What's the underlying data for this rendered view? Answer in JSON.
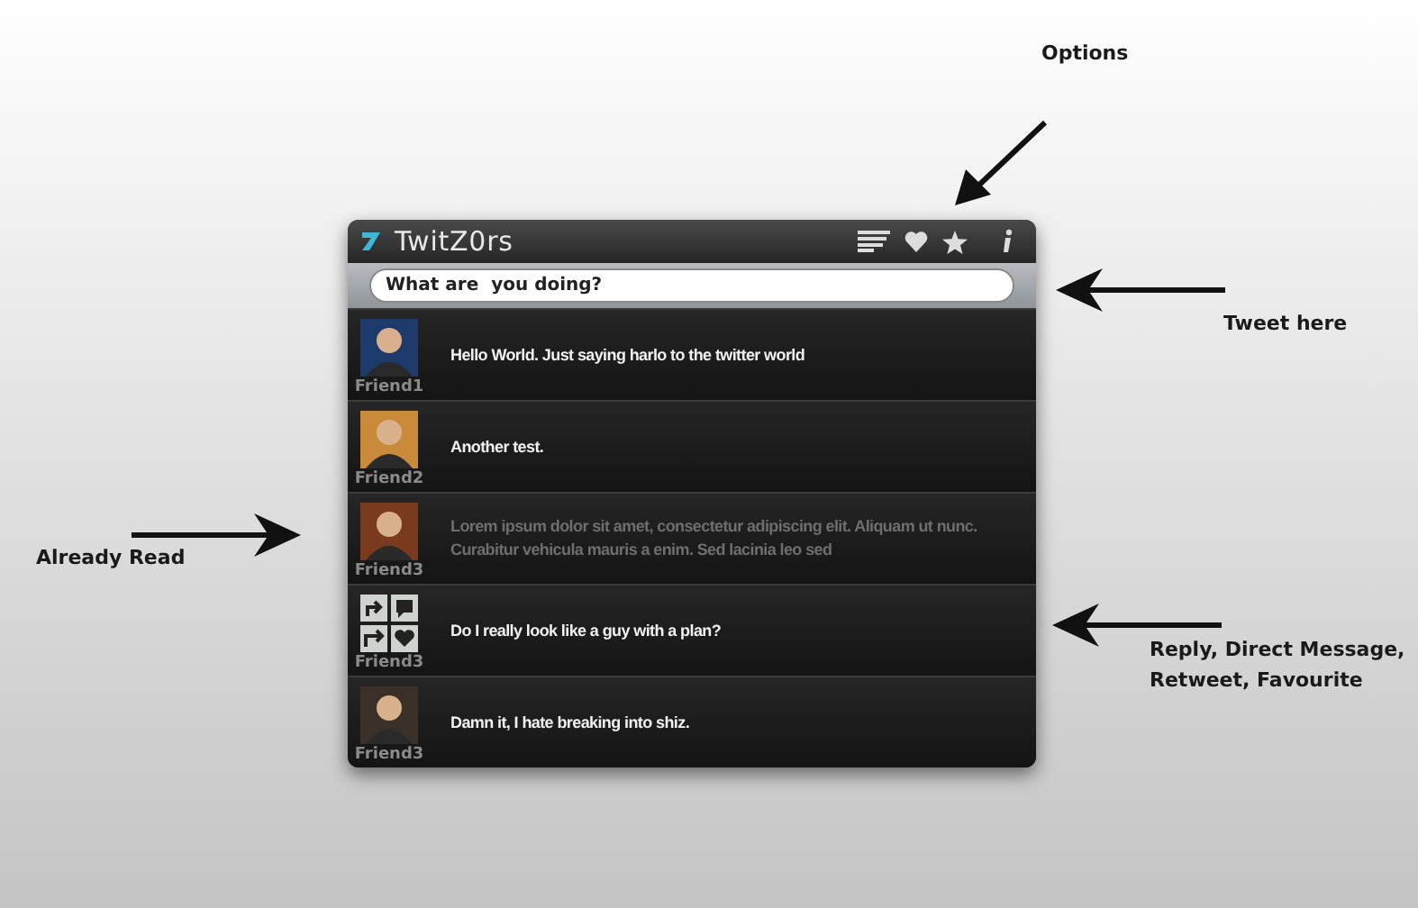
{
  "window": {
    "title": "TwitZ0rs"
  },
  "compose": {
    "placeholder": "What are  you doing?"
  },
  "tweets": [
    {
      "user": "Friend1",
      "text": "Hello World. Just saying harlo to the twitter world",
      "read": false,
      "kind": "avatar"
    },
    {
      "user": "Friend2",
      "text": "Another test.",
      "read": false,
      "kind": "avatar"
    },
    {
      "user": "Friend3",
      "text": "Lorem ipsum dolor sit amet, consectetur adipiscing elit. Aliquam ut nunc. Curabitur vehicula mauris a enim. Sed lacinia leo sed",
      "read": true,
      "kind": "avatar"
    },
    {
      "user": "Friend3",
      "text": "Do I really look like a guy with a plan?",
      "read": false,
      "kind": "actions"
    },
    {
      "user": "Friend3",
      "text": "Damn it, I hate breaking into shiz.",
      "read": false,
      "kind": "avatar"
    }
  ],
  "annotations": [
    {
      "kind": "options",
      "label": "Options"
    },
    {
      "kind": "tweet",
      "label": "Tweet here"
    },
    {
      "kind": "read",
      "label": "Already Read"
    },
    {
      "kind": "actions",
      "label": "Reply, Direct Message, Retweet, Favourite"
    }
  ]
}
